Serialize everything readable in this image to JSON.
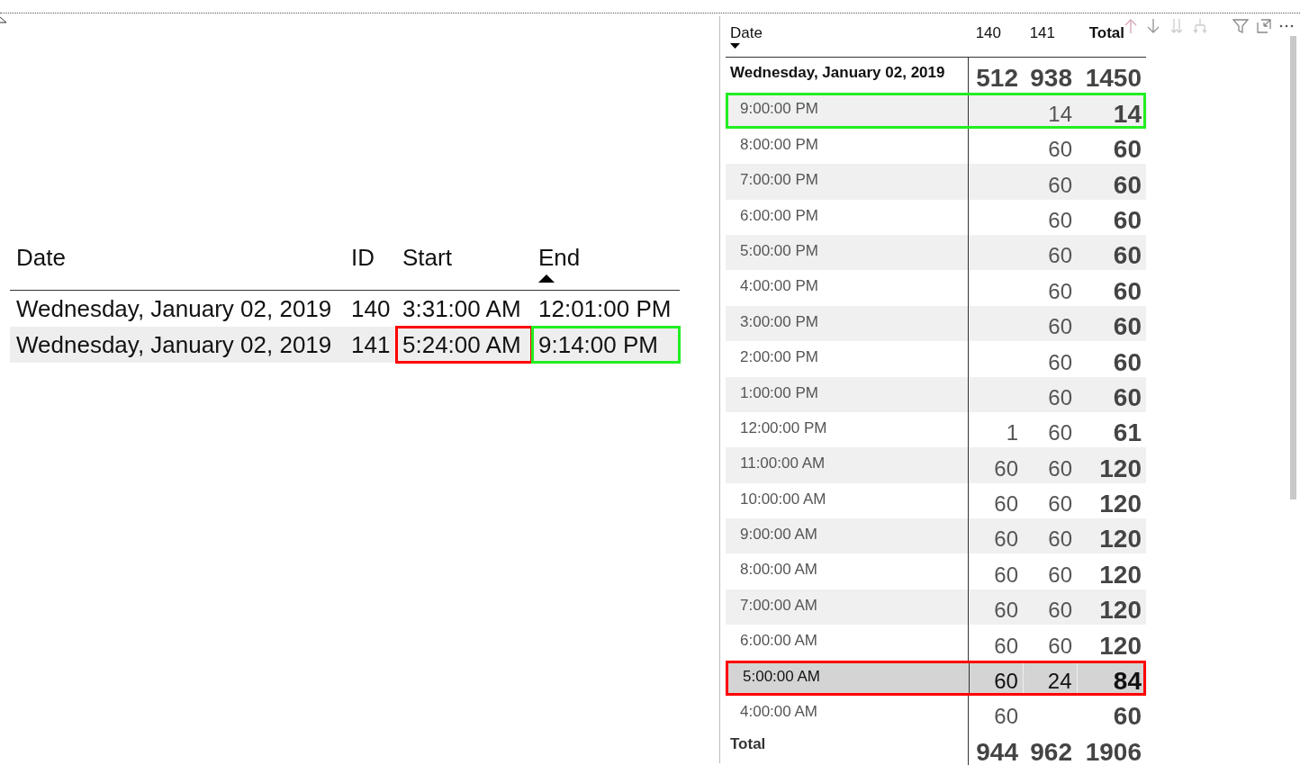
{
  "left_table": {
    "columns": [
      {
        "label": "Date",
        "sorted_ascending": false,
        "sorted_descending": false
      },
      {
        "label": "ID",
        "sorted_ascending": false,
        "sorted_descending": false
      },
      {
        "label": "Start",
        "sorted_ascending": false,
        "sorted_descending": false
      },
      {
        "label": "End",
        "sorted_ascending": true,
        "sorted_descending": false
      }
    ],
    "rows": [
      {
        "cells": [
          {
            "text": "Wednesday, January 02, 2019"
          },
          {
            "text": "140"
          },
          {
            "text": "3:31:00 AM"
          },
          {
            "text": "12:01:00 PM"
          }
        ]
      },
      {
        "cells": [
          {
            "text": "Wednesday, January 02, 2019"
          },
          {
            "text": "141"
          },
          {
            "text": "5:24:00 AM",
            "color": "#ff0000"
          },
          {
            "text": "9:14:00 PM",
            "color": "#22ee22"
          }
        ]
      }
    ]
  },
  "matrix": {
    "columns": [
      {
        "label": "Date",
        "sorted_ascending": false,
        "sorted_descending": true
      },
      {
        "label": "140",
        "sorted_ascending": false,
        "sorted_descending": false
      },
      {
        "label": "141",
        "sorted_ascending": false,
        "sorted_descending": false
      },
      {
        "label": "Total",
        "sorted_ascending": false,
        "sorted_descending": false
      }
    ],
    "group": {
      "label": "Wednesday, January 02, 2019",
      "id_140": "512",
      "id_141": "938",
      "total": "1450"
    },
    "rows": [
      {
        "label": "9:00:00 PM",
        "id_141": "14",
        "total": "14",
        "selected": false,
        "color": "#22ee22"
      },
      {
        "label": "8:00:00 PM",
        "id_141": "60",
        "total": "60",
        "selected": false
      },
      {
        "label": "7:00:00 PM",
        "id_141": "60",
        "total": "60",
        "selected": false
      },
      {
        "label": "6:00:00 PM",
        "id_141": "60",
        "total": "60",
        "selected": false
      },
      {
        "label": "5:00:00 PM",
        "id_141": "60",
        "total": "60",
        "selected": false
      },
      {
        "label": "4:00:00 PM",
        "id_141": "60",
        "total": "60",
        "selected": false
      },
      {
        "label": "3:00:00 PM",
        "id_141": "60",
        "total": "60",
        "selected": false
      },
      {
        "label": "2:00:00 PM",
        "id_141": "60",
        "total": "60",
        "selected": false
      },
      {
        "label": "1:00:00 PM",
        "id_141": "60",
        "total": "60",
        "selected": false
      },
      {
        "label": "12:00:00 PM",
        "id_140": "1",
        "id_141": "60",
        "total": "61",
        "selected": false
      },
      {
        "label": "11:00:00 AM",
        "id_140": "60",
        "id_141": "60",
        "total": "120",
        "selected": false
      },
      {
        "label": "10:00:00 AM",
        "id_140": "60",
        "id_141": "60",
        "total": "120",
        "selected": false
      },
      {
        "label": "9:00:00 AM",
        "id_140": "60",
        "id_141": "60",
        "total": "120",
        "selected": false
      },
      {
        "label": "8:00:00 AM",
        "id_140": "60",
        "id_141": "60",
        "total": "120",
        "selected": false
      },
      {
        "label": "7:00:00 AM",
        "id_140": "60",
        "id_141": "60",
        "total": "120",
        "selected": false
      },
      {
        "label": "6:00:00 AM",
        "id_140": "60",
        "id_141": "60",
        "total": "120",
        "selected": false
      },
      {
        "label": "5:00:00 AM",
        "id_140": "60",
        "id_141": "24",
        "total": "84",
        "selected": true,
        "color": "#ff0000"
      },
      {
        "label": "4:00:00 AM",
        "id_140": "60",
        "total": "60",
        "selected": false
      }
    ],
    "total": {
      "label": "Total",
      "id_140": "944",
      "id_141": "962",
      "total": "1906"
    }
  }
}
